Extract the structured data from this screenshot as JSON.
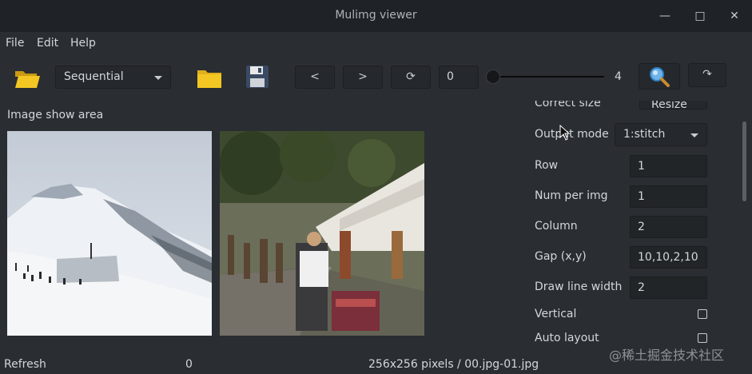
{
  "window": {
    "title": "Mulimg viewer",
    "minimize_glyph": "—",
    "maximize_glyph": "□",
    "close_glyph": "✕"
  },
  "menu": {
    "items": [
      "File",
      "Edit",
      "Help"
    ]
  },
  "toolbar": {
    "open_icon": "open-folder-icon",
    "mode_select": {
      "value": "Sequential"
    },
    "folder_icon": "folder-icon",
    "save_icon": "save-icon",
    "prev_label": "<",
    "next_label": ">",
    "refresh_label": "⟳",
    "index_value": "0",
    "slider_value": 0,
    "slider_max_label": "4",
    "magnify_icon": "magnifier-icon",
    "rotate_label": "↷"
  },
  "image_area": {
    "label": "Image show area",
    "images": [
      {
        "name": "snowy-ski-slope-photo"
      },
      {
        "name": "street-market-photo"
      }
    ]
  },
  "settings": {
    "correct_size_label": "Correct size",
    "correct_size_value": "Resize",
    "output_mode_label": "Output mode",
    "output_mode_value": "1:stitch",
    "row_label": "Row",
    "row_value": "1",
    "num_per_img_label": "Num per img",
    "num_per_img_value": "1",
    "column_label": "Column",
    "column_value": "2",
    "gap_label": "Gap (x,y)",
    "gap_value": "10,10,2,10",
    "draw_line_width_label": "Draw line width",
    "draw_line_width_value": "2",
    "vertical_label": "Vertical",
    "vertical_checked": false,
    "auto_layout_label": "Auto layout",
    "auto_layout_checked": false
  },
  "status": {
    "left": "Refresh",
    "count": "0",
    "info": "256x256 pixels / 00.jpg-01.jpg"
  },
  "watermark": "@稀土掘金技术社区",
  "colors": {
    "background": "#2a2d31",
    "titlebar": "#1f2226",
    "folder_yellow": "#f3c623",
    "save_blue": "#3f6fb4"
  }
}
